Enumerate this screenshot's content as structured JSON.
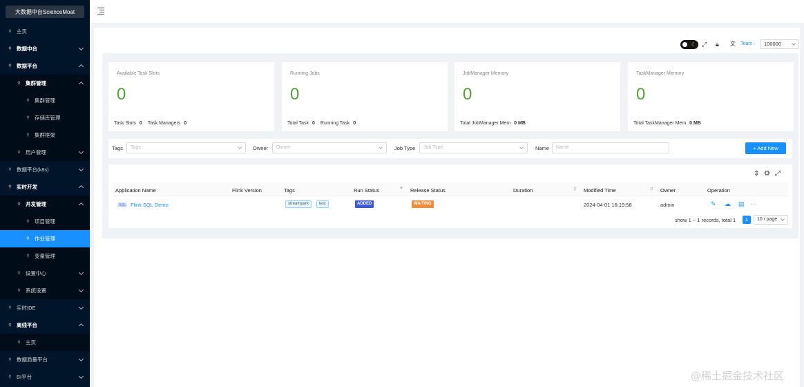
{
  "app": {
    "logo": "大数据中台ScienceMoat"
  },
  "sidebar": {
    "items": [
      {
        "label": "主页"
      },
      {
        "label": "数据中台"
      },
      {
        "label": "数据平台"
      },
      {
        "label": "集群管理"
      },
      {
        "label": "集群管理"
      },
      {
        "label": "存储库管理"
      },
      {
        "label": "集群框架"
      },
      {
        "label": "用户管理"
      },
      {
        "label": "数据平台(k8s)"
      },
      {
        "label": "实时开发"
      },
      {
        "label": "开发管理"
      },
      {
        "label": "项目管理"
      },
      {
        "label": "作业管理"
      },
      {
        "label": "变量管理"
      },
      {
        "label": "设置中心"
      },
      {
        "label": "系统设置"
      },
      {
        "label": "实时IDE"
      },
      {
        "label": "离线平台"
      },
      {
        "label": "主页"
      },
      {
        "label": "数据质量平台"
      },
      {
        "label": "BI平台"
      }
    ]
  },
  "toolbar": {
    "team_label": "Team :",
    "team_value": "100000"
  },
  "cards": [
    {
      "title": "Available Task Slots",
      "value": "0",
      "f1_label": "Task Slots",
      "f1_value": "0",
      "f2_label": "Task Managers",
      "f2_value": "0"
    },
    {
      "title": "Running Jobs",
      "value": "0",
      "f1_label": "Total Task",
      "f1_value": "0",
      "f2_label": "Running Task",
      "f2_value": "0"
    },
    {
      "title": "JobManager Memory",
      "value": "0",
      "f1_label": "Total JobManager Mem",
      "f1_value": "0 MB"
    },
    {
      "title": "TaskManager Memory",
      "value": "0",
      "f1_label": "Total TaskManager Mem",
      "f1_value": "0 MB"
    }
  ],
  "filters": {
    "tags_label": "Tags",
    "tags_placeholder": "Tags",
    "owner_label": "Owner",
    "owner_placeholder": "Owner",
    "jobtype_label": "Job Type",
    "jobtype_placeholder": "Job Type",
    "name_label": "Name",
    "name_placeholder": "Name",
    "add_label": "+ Add New"
  },
  "table": {
    "columns": [
      "Application Name",
      "Flink Version",
      "Tags",
      "Run Status",
      "Release Status",
      "Duration",
      "Modified Time",
      "Owner",
      "Operation"
    ],
    "rows": [
      {
        "type_tag": "SQL",
        "name": "Flink SQL Demo",
        "tags": [
          "streampark",
          "test"
        ],
        "run_status": "ADDED",
        "release_status": "WAITING",
        "modified": "2024-04-01 16:19:58",
        "owner": "admin"
      }
    ],
    "run_status_color": "#3b5bdb",
    "release_status_color": "#f08c3a"
  },
  "pagination": {
    "summary": "show 1 ~ 1 records, total 1",
    "current": "1",
    "page_size": "10 / page"
  },
  "watermark": "@稀土掘金技术社区"
}
